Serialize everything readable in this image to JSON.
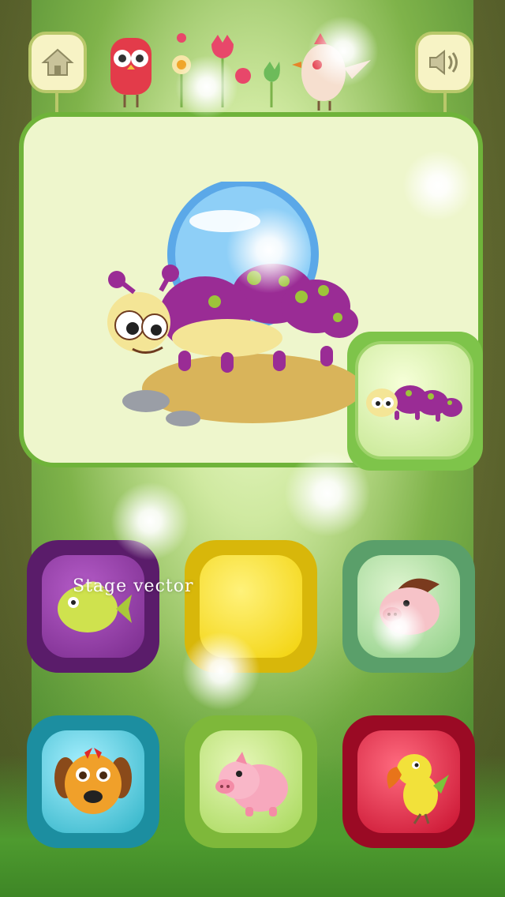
{
  "top_bar": {
    "home_icon": "home-icon",
    "sound_icon": "speaker-icon",
    "decorations": [
      "owl",
      "flower",
      "tulip",
      "bird"
    ]
  },
  "featured": {
    "animal": "caterpillar",
    "thumbnail": "caterpillar"
  },
  "overlay": {
    "watermark_text": "Stage vector"
  },
  "tiles": [
    {
      "animal": "fish",
      "color": "#7a2c8d"
    },
    {
      "animal": "empty",
      "color": "#f2d20a"
    },
    {
      "animal": "hedgehog-pig",
      "color": "#8fcf86"
    },
    {
      "animal": "dog",
      "color": "#2fb3c7"
    },
    {
      "animal": "pig",
      "color": "#a7d85a"
    },
    {
      "animal": "parrot",
      "color": "#c8112f"
    }
  ],
  "colors": {
    "card_border": "#6fb33a",
    "card_bg": "#eef6cc",
    "button_border": "#b9c86a"
  }
}
